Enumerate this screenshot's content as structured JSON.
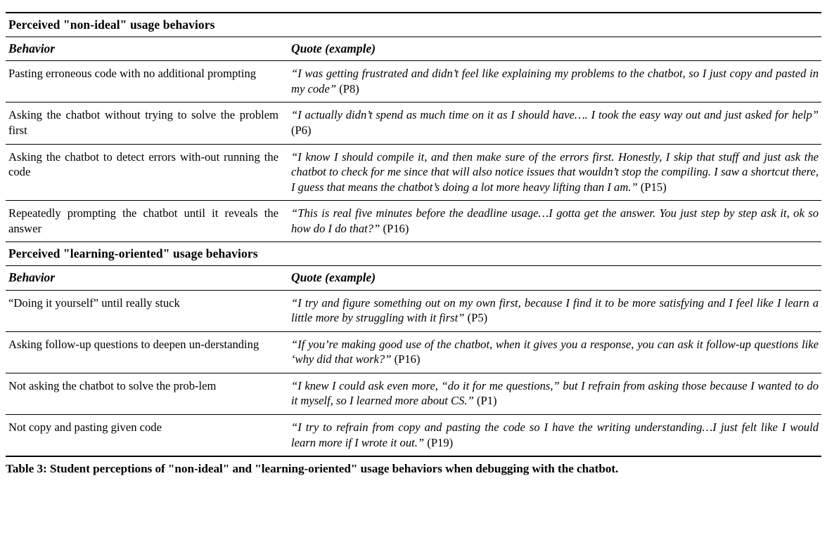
{
  "table": {
    "columns": [
      "Behavior",
      "Quote (example)"
    ],
    "sections": [
      {
        "title": "Perceived \"non-ideal\" usage behaviors",
        "col_behavior": "Behavior",
        "col_quote": "Quote (example)",
        "rows": [
          {
            "behavior": "Pasting erroneous code with no additional prompting",
            "quote": "“I was getting frustrated and didn’t feel like explaining my problems to the chatbot, so I just copy and pasted in my code”",
            "participant": "(P8)"
          },
          {
            "behavior": "Asking the chatbot without trying to solve the problem first",
            "quote": "“I actually didn’t spend as much time on it as I should have…. I took the easy way out and just asked for help”",
            "participant": "(P6)"
          },
          {
            "behavior": "Asking the chatbot to detect errors with-out running the code",
            "quote": "“I know I should compile it, and then make sure of the errors first. Honestly, I skip that stuff and just ask the chatbot to check for me since that will also notice issues that wouldn’t stop the compiling. I saw a shortcut there, I guess that means the chatbot’s doing a lot more heavy lifting than I am.”",
            "participant": "(P15)"
          },
          {
            "behavior": "Repeatedly prompting the chatbot until it reveals the answer",
            "quote": "“This is real five minutes before the deadline usage…I gotta get the answer. You just step by step ask it, ok so how do I do that?”",
            "participant": "(P16)"
          }
        ]
      },
      {
        "title": "Perceived \"learning-oriented\" usage behaviors",
        "col_behavior": "Behavior",
        "col_quote": "Quote (example)",
        "rows": [
          {
            "behavior": "“Doing it yourself” until really stuck",
            "quote": "“I try and figure something out on my own first, because I find it to be more satisfying and I feel like I learn a little more by struggling with it first”",
            "participant": "(P5)"
          },
          {
            "behavior": "Asking follow-up questions to deepen un-derstanding",
            "quote": "“If you’re making good use of the chatbot, when it gives you a response, you can ask it follow-up questions like ‘why did that work?”",
            "participant": "(P16)"
          },
          {
            "behavior": "Not asking the chatbot to solve the prob-lem",
            "quote": "“I knew I could ask even more, “do it for me questions,” but I refrain from asking those because I wanted to do it myself, so I learned more about CS.”",
            "participant": "(P1)"
          },
          {
            "behavior": "Not copy and pasting given code",
            "quote": "“I try to refrain from copy and pasting the code so I have the writing understanding…I just felt like I would learn more if I wrote it out.”",
            "participant": "(P19)"
          }
        ]
      }
    ]
  },
  "caption": "Table 3: Student perceptions of \"non-ideal\" and \"learning-oriented\" usage behaviors when debugging with the chatbot."
}
